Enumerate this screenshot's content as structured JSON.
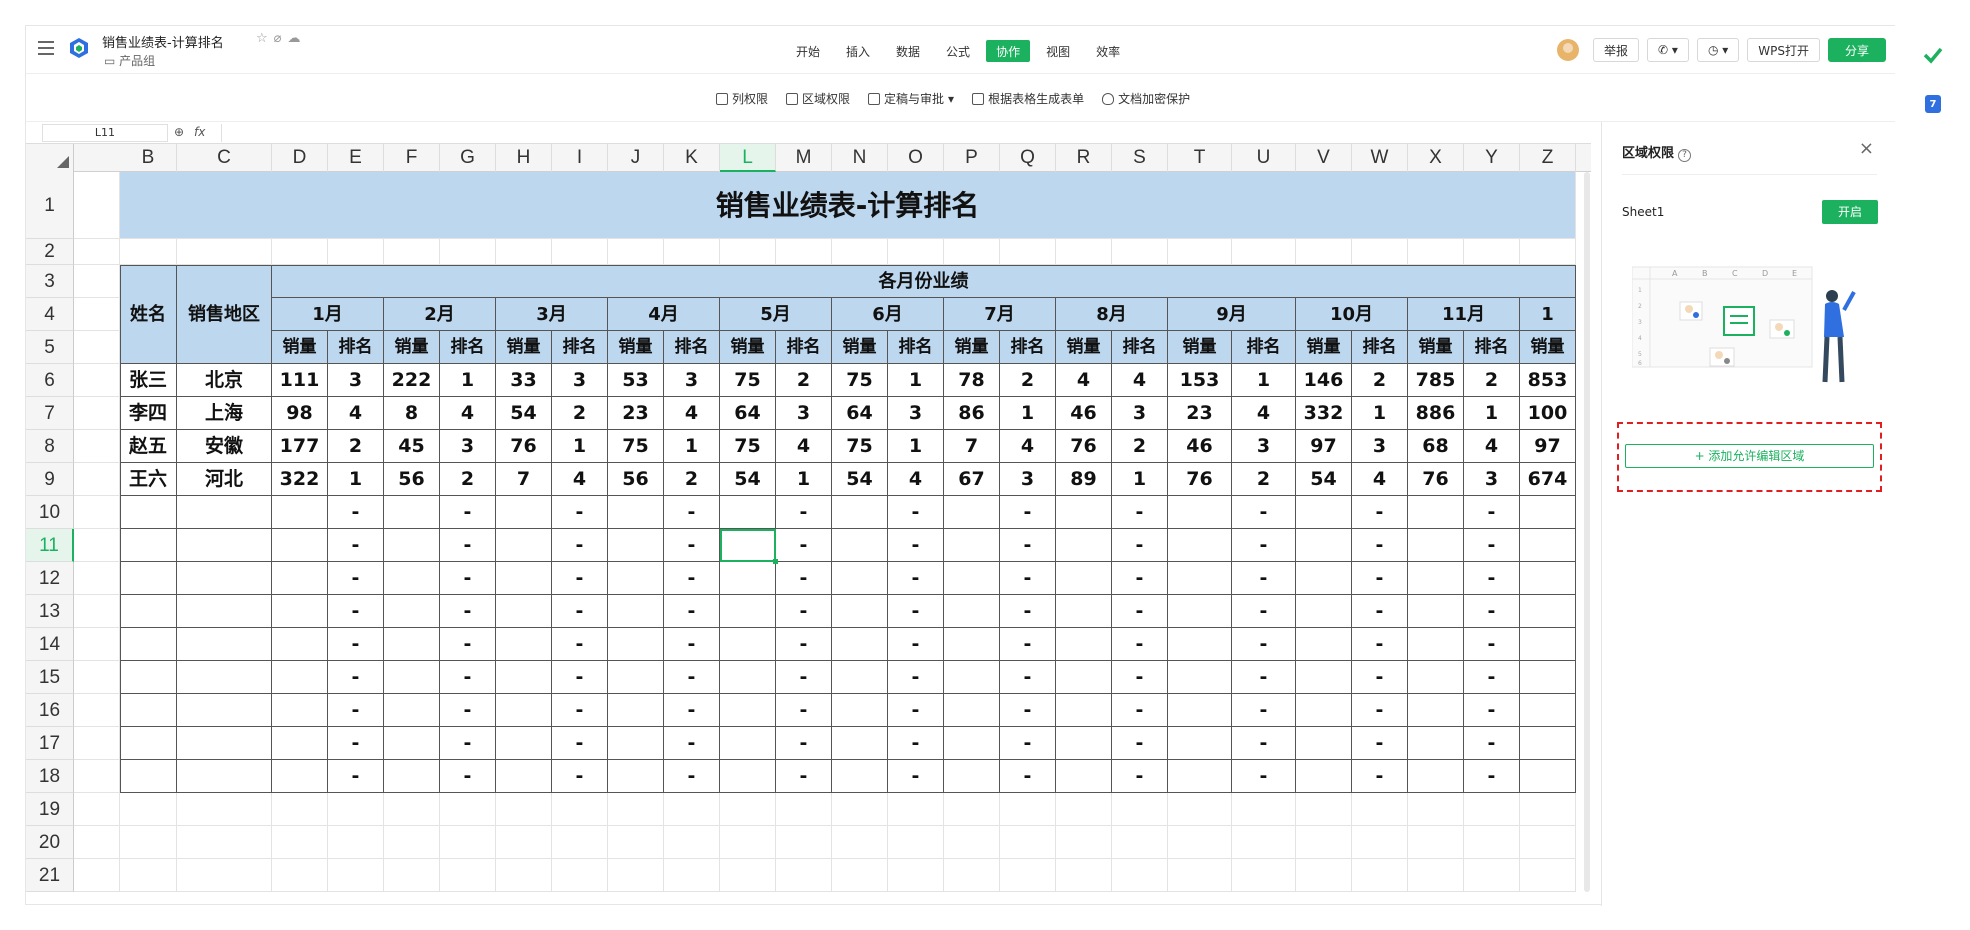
{
  "header": {
    "doc_title": "销售业绩表-计算排名",
    "folder": "产品组",
    "menu": [
      "开始",
      "插入",
      "数据",
      "公式",
      "协作",
      "视图",
      "效率"
    ],
    "active_menu": "协作",
    "report": "举报",
    "wps_open": "WPS打开",
    "share": "分享"
  },
  "toolbar": {
    "items": [
      "列权限",
      "区域权限",
      "定稿与审批",
      "根据表格生成表单",
      "文档加密保护"
    ]
  },
  "formula_bar": {
    "cell_ref": "L11",
    "fx": "fx"
  },
  "grid": {
    "columns": [
      "B",
      "C",
      "D",
      "E",
      "F",
      "G",
      "H",
      "I",
      "J",
      "K",
      "L",
      "M",
      "N",
      "O",
      "P",
      "Q",
      "R",
      "S",
      "T",
      "U",
      "V",
      "W",
      "X",
      "Y",
      "Z"
    ],
    "selected_column": "L",
    "rows": [
      "1",
      "2",
      "3",
      "4",
      "5",
      "6",
      "7",
      "8",
      "9",
      "10",
      "11",
      "12",
      "13",
      "14",
      "15",
      "16",
      "17",
      "18",
      "19",
      "20",
      "21"
    ],
    "selected_row": "11",
    "sheet_title": "销售业绩表-计算排名",
    "group_header": "各月份业绩",
    "name_header": "姓名",
    "region_header": "销售地区",
    "months": [
      "1月",
      "2月",
      "3月",
      "4月",
      "5月",
      "6月",
      "7月",
      "8月",
      "9月",
      "10月",
      "11月",
      "1"
    ],
    "sales_label": "销量",
    "rank_label": "排名",
    "people": [
      {
        "name": "张三",
        "region": "北京",
        "values": [
          "111",
          "3",
          "222",
          "1",
          "33",
          "3",
          "53",
          "3",
          "75",
          "2",
          "75",
          "1",
          "78",
          "2",
          "4",
          "4",
          "153",
          "1",
          "146",
          "2",
          "785",
          "2",
          "853"
        ]
      },
      {
        "name": "李四",
        "region": "上海",
        "values": [
          "98",
          "4",
          "8",
          "4",
          "54",
          "2",
          "23",
          "4",
          "64",
          "3",
          "64",
          "3",
          "86",
          "1",
          "46",
          "3",
          "23",
          "4",
          "332",
          "1",
          "886",
          "1",
          "100"
        ]
      },
      {
        "name": "赵五",
        "region": "安徽",
        "values": [
          "177",
          "2",
          "45",
          "3",
          "76",
          "1",
          "75",
          "1",
          "75",
          "4",
          "75",
          "1",
          "7",
          "4",
          "76",
          "2",
          "46",
          "3",
          "97",
          "3",
          "68",
          "4",
          "97"
        ]
      },
      {
        "name": "王六",
        "region": "河北",
        "values": [
          "322",
          "1",
          "56",
          "2",
          "7",
          "4",
          "56",
          "2",
          "54",
          "1",
          "54",
          "4",
          "67",
          "3",
          "89",
          "1",
          "76",
          "2",
          "54",
          "4",
          "76",
          "3",
          "674"
        ]
      }
    ],
    "dash": "-"
  },
  "panel": {
    "title": "区域权限",
    "help": "?",
    "close": "×",
    "sheet": "Sheet1",
    "open_label": "开启",
    "add_label": "+ 添加允许编辑区域",
    "illus_cols": [
      "A",
      "B",
      "C",
      "D",
      "E"
    ],
    "illus_rows": [
      "1",
      "2",
      "3",
      "4",
      "5",
      "6"
    ]
  },
  "rail": {
    "calendar_day": "7"
  },
  "colors": {
    "accent": "#1bb15e",
    "header_blue": "#bdd7ee",
    "dash_red": "#e02020"
  }
}
